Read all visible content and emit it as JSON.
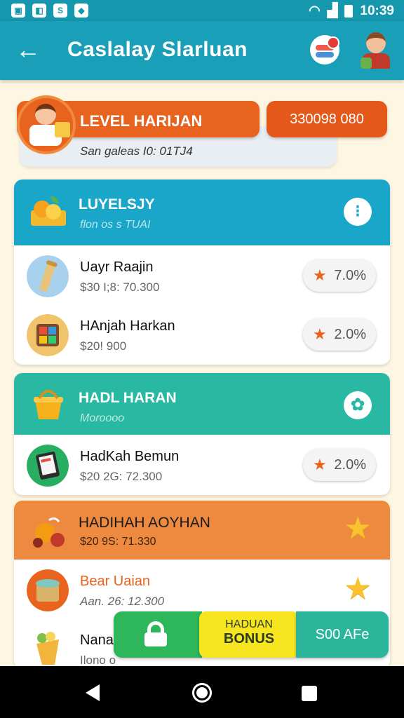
{
  "status_bar": {
    "time": "10:39"
  },
  "app_bar": {
    "title": "Caslalay Slarluan"
  },
  "level": {
    "title": "LEVEL HARIJAN",
    "score": "330098 080",
    "subtitle": "San galeas I0: 01TJ4"
  },
  "sections": [
    {
      "title": "LUYELSJY",
      "subtitle": "flon os s TUAI",
      "color": "#1aa6c9",
      "items": [
        {
          "name": "Uayr Raajin",
          "value": "$30 I;8: 70.300",
          "rate": "7.0%"
        },
        {
          "name": "HAnjah Harkan",
          "value": "$20! 900",
          "rate": "2.0%"
        }
      ]
    },
    {
      "title": "HADL HARAN",
      "subtitle": "Moroooo",
      "color": "#29b9a3",
      "items": [
        {
          "name": "HadKah Bemun",
          "value": "$20 2G: 72.300",
          "rate": "2.0%"
        }
      ]
    },
    {
      "title": "HADIHAH AOYHAN",
      "subtitle": "$20 9S: 71.330",
      "color": "#ed8a3f",
      "items": [
        {
          "name": "Bear Uaian",
          "value": "Aan. 26: 12.300"
        },
        {
          "name": "Nanak",
          "value": "Ilono o"
        }
      ]
    }
  ],
  "bottom_actions": {
    "bonus_top": "HADUAN",
    "bonus_bottom": "BONUS",
    "amount": "S00 AFe"
  }
}
